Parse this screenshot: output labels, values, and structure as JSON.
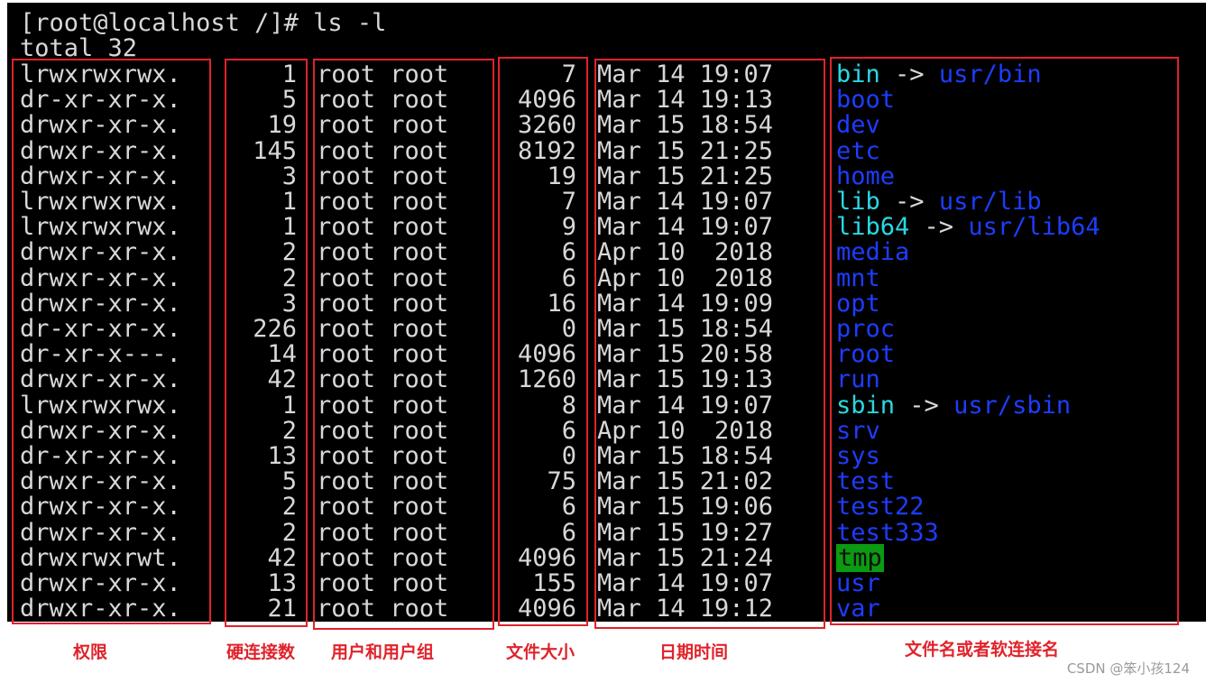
{
  "terminal": {
    "prompt_line": "[root@localhost /]# ls -l",
    "total_line": "total 32",
    "entries": [
      {
        "perm": "lrwxrwxrwx.",
        "links": "1",
        "owner": "root root",
        "size": "7",
        "date": "Mar 14 19:07",
        "name": "bin",
        "kind": "link",
        "target": "usr/bin"
      },
      {
        "perm": "dr-xr-xr-x.",
        "links": "5",
        "owner": "root root",
        "size": "4096",
        "date": "Mar 14 19:13",
        "name": "boot",
        "kind": "dir"
      },
      {
        "perm": "drwxr-xr-x.",
        "links": "19",
        "owner": "root root",
        "size": "3260",
        "date": "Mar 15 18:54",
        "name": "dev",
        "kind": "dir"
      },
      {
        "perm": "drwxr-xr-x.",
        "links": "145",
        "owner": "root root",
        "size": "8192",
        "date": "Mar 15 21:25",
        "name": "etc",
        "kind": "dir"
      },
      {
        "perm": "drwxr-xr-x.",
        "links": "3",
        "owner": "root root",
        "size": "19",
        "date": "Mar 15 21:25",
        "name": "home",
        "kind": "dir"
      },
      {
        "perm": "lrwxrwxrwx.",
        "links": "1",
        "owner": "root root",
        "size": "7",
        "date": "Mar 14 19:07",
        "name": "lib",
        "kind": "link",
        "target": "usr/lib"
      },
      {
        "perm": "lrwxrwxrwx.",
        "links": "1",
        "owner": "root root",
        "size": "9",
        "date": "Mar 14 19:07",
        "name": "lib64",
        "kind": "link",
        "target": "usr/lib64"
      },
      {
        "perm": "drwxr-xr-x.",
        "links": "2",
        "owner": "root root",
        "size": "6",
        "date": "Apr 10  2018",
        "name": "media",
        "kind": "dir"
      },
      {
        "perm": "drwxr-xr-x.",
        "links": "2",
        "owner": "root root",
        "size": "6",
        "date": "Apr 10  2018",
        "name": "mnt",
        "kind": "dir"
      },
      {
        "perm": "drwxr-xr-x.",
        "links": "3",
        "owner": "root root",
        "size": "16",
        "date": "Mar 14 19:09",
        "name": "opt",
        "kind": "dir"
      },
      {
        "perm": "dr-xr-xr-x.",
        "links": "226",
        "owner": "root root",
        "size": "0",
        "date": "Mar 15 18:54",
        "name": "proc",
        "kind": "dir"
      },
      {
        "perm": "dr-xr-x---.",
        "links": "14",
        "owner": "root root",
        "size": "4096",
        "date": "Mar 15 20:58",
        "name": "root",
        "kind": "dir"
      },
      {
        "perm": "drwxr-xr-x.",
        "links": "42",
        "owner": "root root",
        "size": "1260",
        "date": "Mar 15 19:13",
        "name": "run",
        "kind": "dir"
      },
      {
        "perm": "lrwxrwxrwx.",
        "links": "1",
        "owner": "root root",
        "size": "8",
        "date": "Mar 14 19:07",
        "name": "sbin",
        "kind": "link",
        "target": "usr/sbin"
      },
      {
        "perm": "drwxr-xr-x.",
        "links": "2",
        "owner": "root root",
        "size": "6",
        "date": "Apr 10  2018",
        "name": "srv",
        "kind": "dir"
      },
      {
        "perm": "dr-xr-xr-x.",
        "links": "13",
        "owner": "root root",
        "size": "0",
        "date": "Mar 15 18:54",
        "name": "sys",
        "kind": "dir"
      },
      {
        "perm": "drwxr-xr-x.",
        "links": "5",
        "owner": "root root",
        "size": "75",
        "date": "Mar 15 21:02",
        "name": "test",
        "kind": "dir"
      },
      {
        "perm": "drwxr-xr-x.",
        "links": "2",
        "owner": "root root",
        "size": "6",
        "date": "Mar 15 19:06",
        "name": "test22",
        "kind": "dir"
      },
      {
        "perm": "drwxr-xr-x.",
        "links": "2",
        "owner": "root root",
        "size": "6",
        "date": "Mar 15 19:27",
        "name": "test333",
        "kind": "dir"
      },
      {
        "perm": "drwxrwxrwt.",
        "links": "42",
        "owner": "root root",
        "size": "4096",
        "date": "Mar 15 21:24",
        "name": "tmp",
        "kind": "sticky"
      },
      {
        "perm": "drwxr-xr-x.",
        "links": "13",
        "owner": "root root",
        "size": "155",
        "date": "Mar 14 19:07",
        "name": "usr",
        "kind": "dir"
      },
      {
        "perm": "drwxr-xr-x.",
        "links": "21",
        "owner": "root root",
        "size": "4096",
        "date": "Mar 14 19:12",
        "name": "var",
        "kind": "dir"
      }
    ]
  },
  "annotations": {
    "permissions": "权限",
    "hard_links": "硬连接数",
    "user_group": "用户和用户组",
    "file_size": "文件大小",
    "date_time": "日期时间",
    "file_name": "文件名或者软连接名"
  },
  "watermark": "CSDN @笨小孩124",
  "colors": {
    "terminal_bg": "#000000",
    "text": "#d8d8d8",
    "directory": "#1d3dff",
    "symlink": "#29d8e2",
    "sticky_bg": "#0b9a12",
    "annotation_red": "#e0232b"
  }
}
